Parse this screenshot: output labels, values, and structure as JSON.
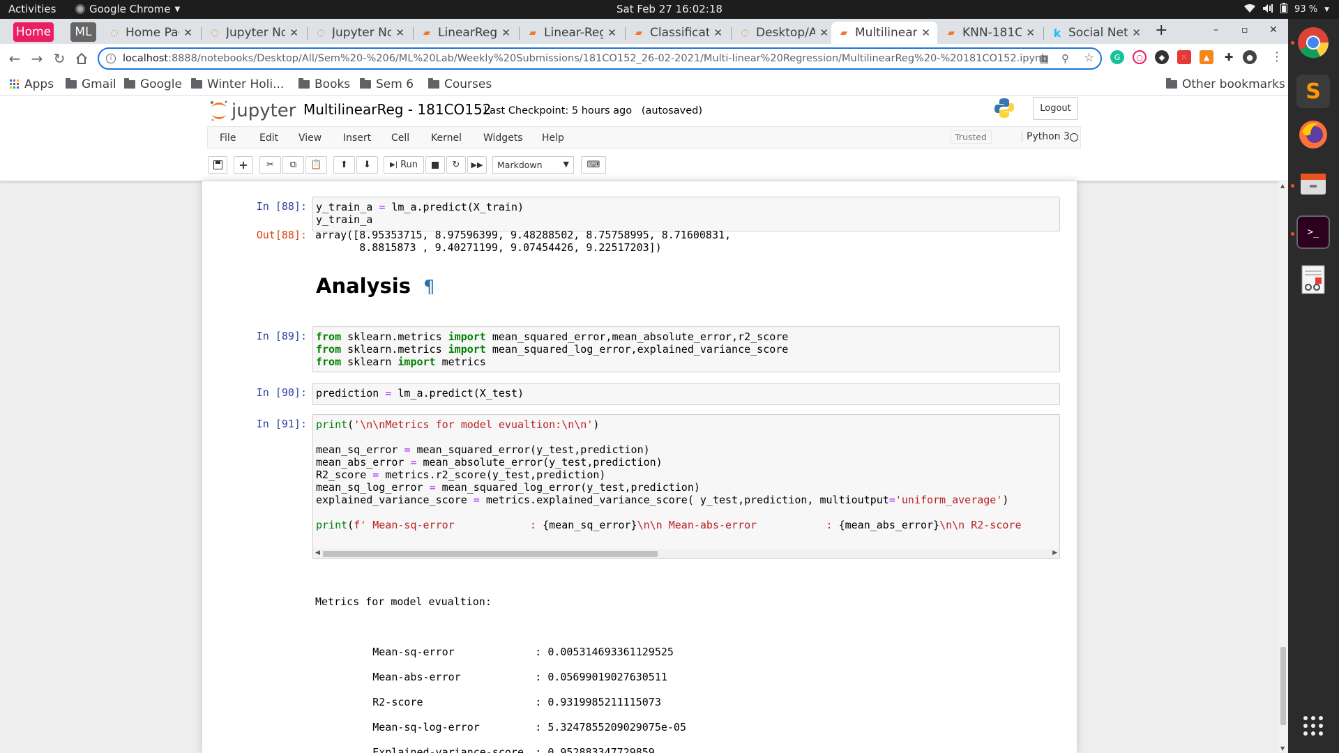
{
  "system": {
    "activities": "Activities",
    "app_name": "Google Chrome",
    "clock": "Sat Feb 27  16:02:18",
    "battery": "93 %"
  },
  "browser": {
    "pinned_tabs": [
      {
        "label": "Home",
        "color": "#e91e63"
      },
      {
        "label": "ML",
        "color": "#666666"
      }
    ],
    "tabs": [
      {
        "label": "Home Page",
        "icon": "jupyter-icon"
      },
      {
        "label": "Jupyter No",
        "icon": "jupyter-icon"
      },
      {
        "label": "Jupyter No",
        "icon": "jupyter-icon"
      },
      {
        "label": "LinearReg",
        "icon": "notebook-icon"
      },
      {
        "label": "Linear-Reg",
        "icon": "notebook-icon"
      },
      {
        "label": "Classificati",
        "icon": "notebook-icon"
      },
      {
        "label": "Desktop/A",
        "icon": "jupyter-icon"
      },
      {
        "label": "Multilinear",
        "icon": "notebook-icon",
        "active": true
      },
      {
        "label": "KNN-181C",
        "icon": "notebook-icon"
      },
      {
        "label": "Social Netv",
        "icon": "kaggle-icon"
      }
    ],
    "url_host": "localhost",
    "url_path": ":8888/notebooks/Desktop/All/Sem%20-%206/ML%20Lab/Weekly%20Submissions/181CO152_26-02-2021/Multi-linear%20Regression/MultilinearReg%20-%20181CO152.ipynb",
    "bookmarks": [
      {
        "label": "Apps",
        "type": "apps"
      },
      {
        "label": "Gmail",
        "type": "folder"
      },
      {
        "label": "Google",
        "type": "folder"
      },
      {
        "label": "Winter Holi...",
        "type": "folder"
      },
      {
        "label": "Books",
        "type": "folder"
      },
      {
        "label": "Sem 6",
        "type": "folder"
      },
      {
        "label": "Courses",
        "type": "folder"
      }
    ],
    "other_bookmarks": "Other bookmarks"
  },
  "jupyter": {
    "logo_text": "jupyter",
    "notebook_title": "MultilinearReg - 181CO152",
    "checkpoint": "Last Checkpoint: 5 hours ago",
    "autosaved": "(autosaved)",
    "logout_label": "Logout",
    "menu": [
      "File",
      "Edit",
      "View",
      "Insert",
      "Cell",
      "Kernel",
      "Widgets",
      "Help"
    ],
    "trusted": "Trusted",
    "kernel_name": "Python 3",
    "run_label": "Run",
    "cell_type": "Markdown"
  },
  "cells": {
    "c88": {
      "prompt_in": "In [88]:",
      "prompt_out": "Out[88]:",
      "output": "array([8.95353715, 8.97596399, 9.48288502, 8.75758995, 8.71600831,\n       8.8815873 , 9.40271199, 9.07454426, 9.22517203])"
    },
    "heading": "Analysis",
    "heading_anchor": "¶",
    "c89": {
      "prompt_in": "In [89]:"
    },
    "c90": {
      "prompt_in": "In [90]:"
    },
    "c91": {
      "prompt_in": "In [91]:",
      "output_title": "Metrics for model evualtion:",
      "metrics": [
        {
          "name": "Mean-sq-error",
          "value": "0.005314693361129525"
        },
        {
          "name": "Mean-abs-error",
          "value": "0.05699019027630511"
        },
        {
          "name": "R2-score",
          "value": "0.9319985211115073"
        },
        {
          "name": "Mean-sq-log-error",
          "value": "5.3247855209029075e-05"
        },
        {
          "name": "Explained-variance-score",
          "value": "0.952883347729859"
        }
      ]
    }
  },
  "colors": {
    "accent": "#1a73e8",
    "jupyter_orange": "#f37726",
    "prompt_in": "#303f9f",
    "prompt_out": "#d84315"
  }
}
